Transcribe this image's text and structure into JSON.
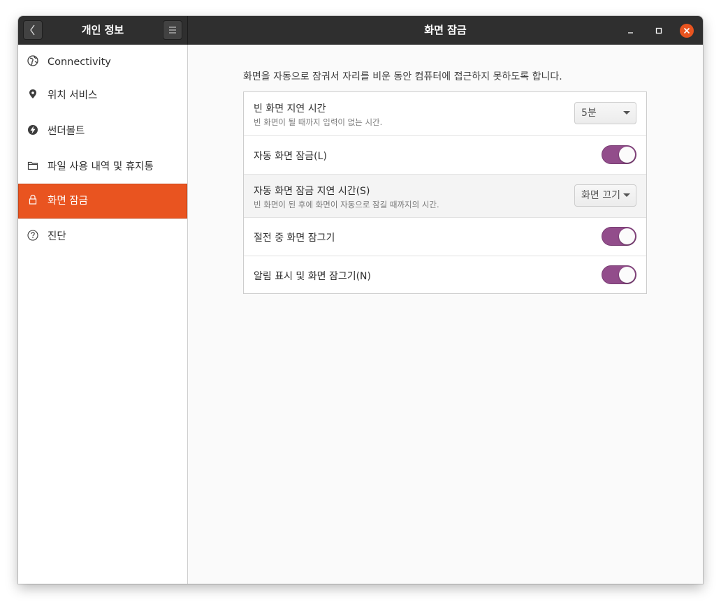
{
  "titlebar": {
    "left_title": "개인 정보",
    "main_title": "화면 잠금"
  },
  "sidebar": {
    "items": [
      {
        "label": "Connectivity",
        "icon": "globe-icon",
        "active": false
      },
      {
        "label": "위치 서비스",
        "icon": "location-pin-icon",
        "active": false
      },
      {
        "label": "썬더볼트",
        "icon": "thunderbolt-icon",
        "active": false
      },
      {
        "label": "파일 사용 내역 및 휴지통",
        "icon": "folder-icon",
        "active": false
      },
      {
        "label": "화면 잠금",
        "icon": "lock-icon",
        "active": true
      },
      {
        "label": "진단",
        "icon": "help-icon",
        "active": false
      }
    ]
  },
  "main": {
    "description": "화면을 자동으로 잠궈서 자리를 비운 동안 컴퓨터에 접근하지 못하도록 합니다.",
    "rows": [
      {
        "title": "빈 화면 지연 시간",
        "subtitle": "빈 화면이 될 때까지 입력이 없는 시간.",
        "control": "dropdown",
        "value": "5분"
      },
      {
        "title": "자동 화면 잠금(L)",
        "control": "toggle",
        "value": "on"
      },
      {
        "title": "자동 화면 잠금 지연 시간(S)",
        "subtitle": "빈 화면이 된 후에 화면이 자동으로 잠길 때까지의 시간.",
        "control": "dropdown",
        "value": "화면 끄기"
      },
      {
        "title": "절전 중 화면 잠그기",
        "control": "toggle",
        "value": "on"
      },
      {
        "title": "알림 표시 및 화면 잠그기(N)",
        "control": "toggle",
        "value": "on"
      }
    ]
  },
  "colors": {
    "accent": "#e95420",
    "toggle_on": "#924d8b",
    "titlebar": "#2f2f2f"
  }
}
